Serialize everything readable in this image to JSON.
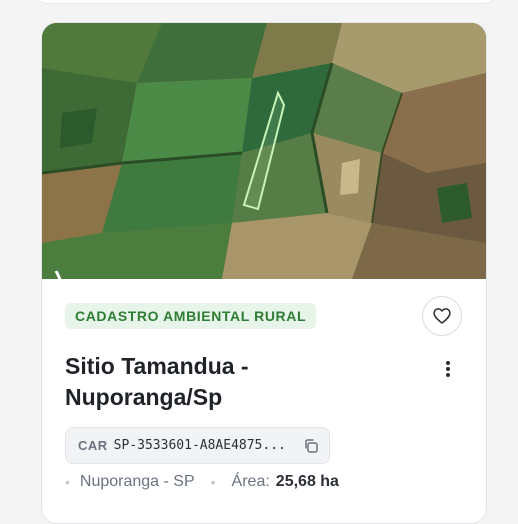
{
  "card": {
    "badge": {
      "label": "CADASTRO AMBIENTAL RURAL",
      "bg_color": "#e6f4ea",
      "text_color": "#2e7d32"
    },
    "title": "Sitio Tamandua - Nuporanga/Sp",
    "car": {
      "label": "CAR",
      "code": "SP-3533601-A8AE4875..."
    },
    "location": "Nuporanga - SP",
    "area_label": "Área:",
    "area_value": "25,68 ha",
    "icons": {
      "favorite": "heart-icon",
      "more": "more-vertical-icon",
      "copy": "copy-icon"
    },
    "map": {
      "boundary_color": "#c6f3b8"
    }
  }
}
